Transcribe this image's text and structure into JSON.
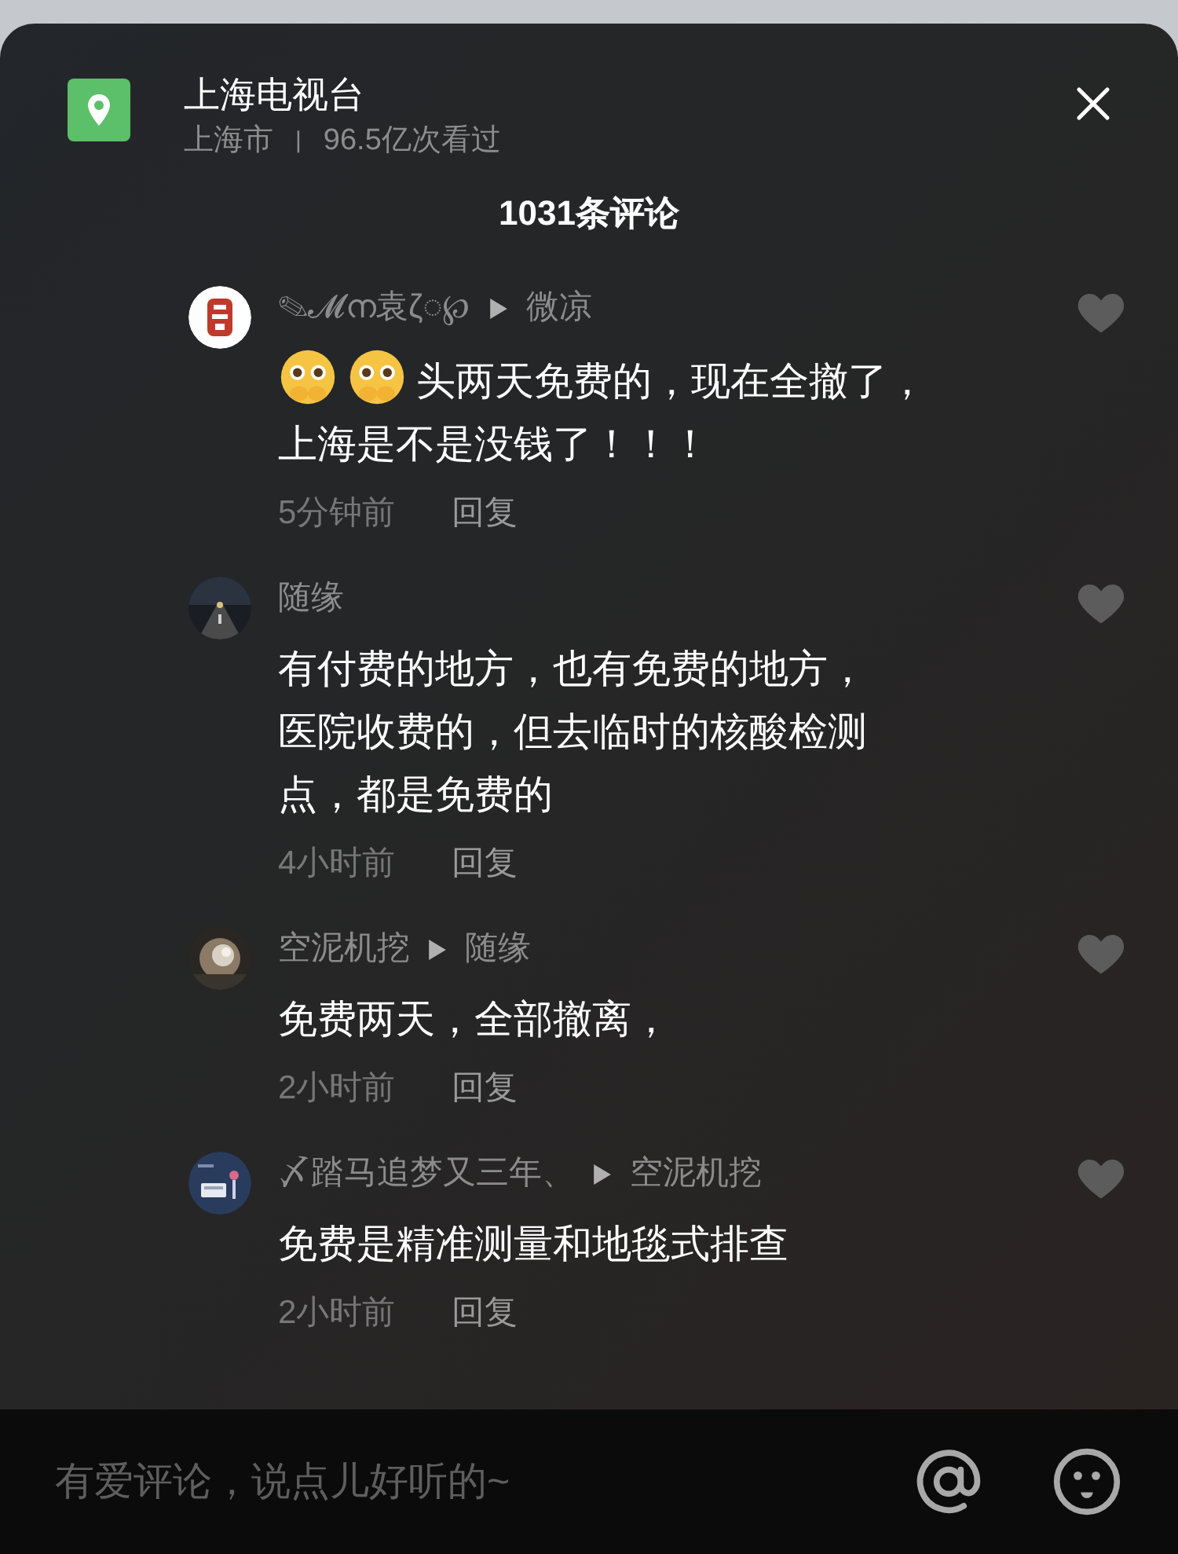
{
  "header": {
    "title": "上海电视台",
    "location": "上海市",
    "separator": "|",
    "views": "96.5亿次看过"
  },
  "comment_count": "1031条评论",
  "comments": [
    {
      "author": "✎𝓜ന袁ζ◌℘",
      "reply_to": "微凉",
      "stickers": [
        {
          "kind": "pleading-face"
        },
        {
          "kind": "pleading-face"
        }
      ],
      "lines": [
        "头两天免费的，现在全撤了，",
        "上海是不是没钱了！！！"
      ],
      "time": "5分钟前",
      "reply": "回复",
      "liked": false
    },
    {
      "author": "随缘",
      "lines": [
        "有付费的地方，也有免费的地方，",
        "医院收费的，但去临时的核酸检测",
        "点，都是免费的"
      ],
      "time": "4小时前",
      "reply": "回复",
      "liked": false
    },
    {
      "author": "空泥机挖",
      "reply_to": "随缘",
      "lines": [
        "免费两天，全部撤离，"
      ],
      "time": "2小时前",
      "reply": "回复",
      "liked": false
    },
    {
      "author": "〆踏马追梦又三年、",
      "reply_to": "空泥机挖",
      "lines": [
        "免费是精准测量和地毯式排查"
      ],
      "time": "2小时前",
      "reply": "回复",
      "liked": false
    }
  ],
  "input": {
    "placeholder": "有爱评论，说点儿好听的~"
  }
}
